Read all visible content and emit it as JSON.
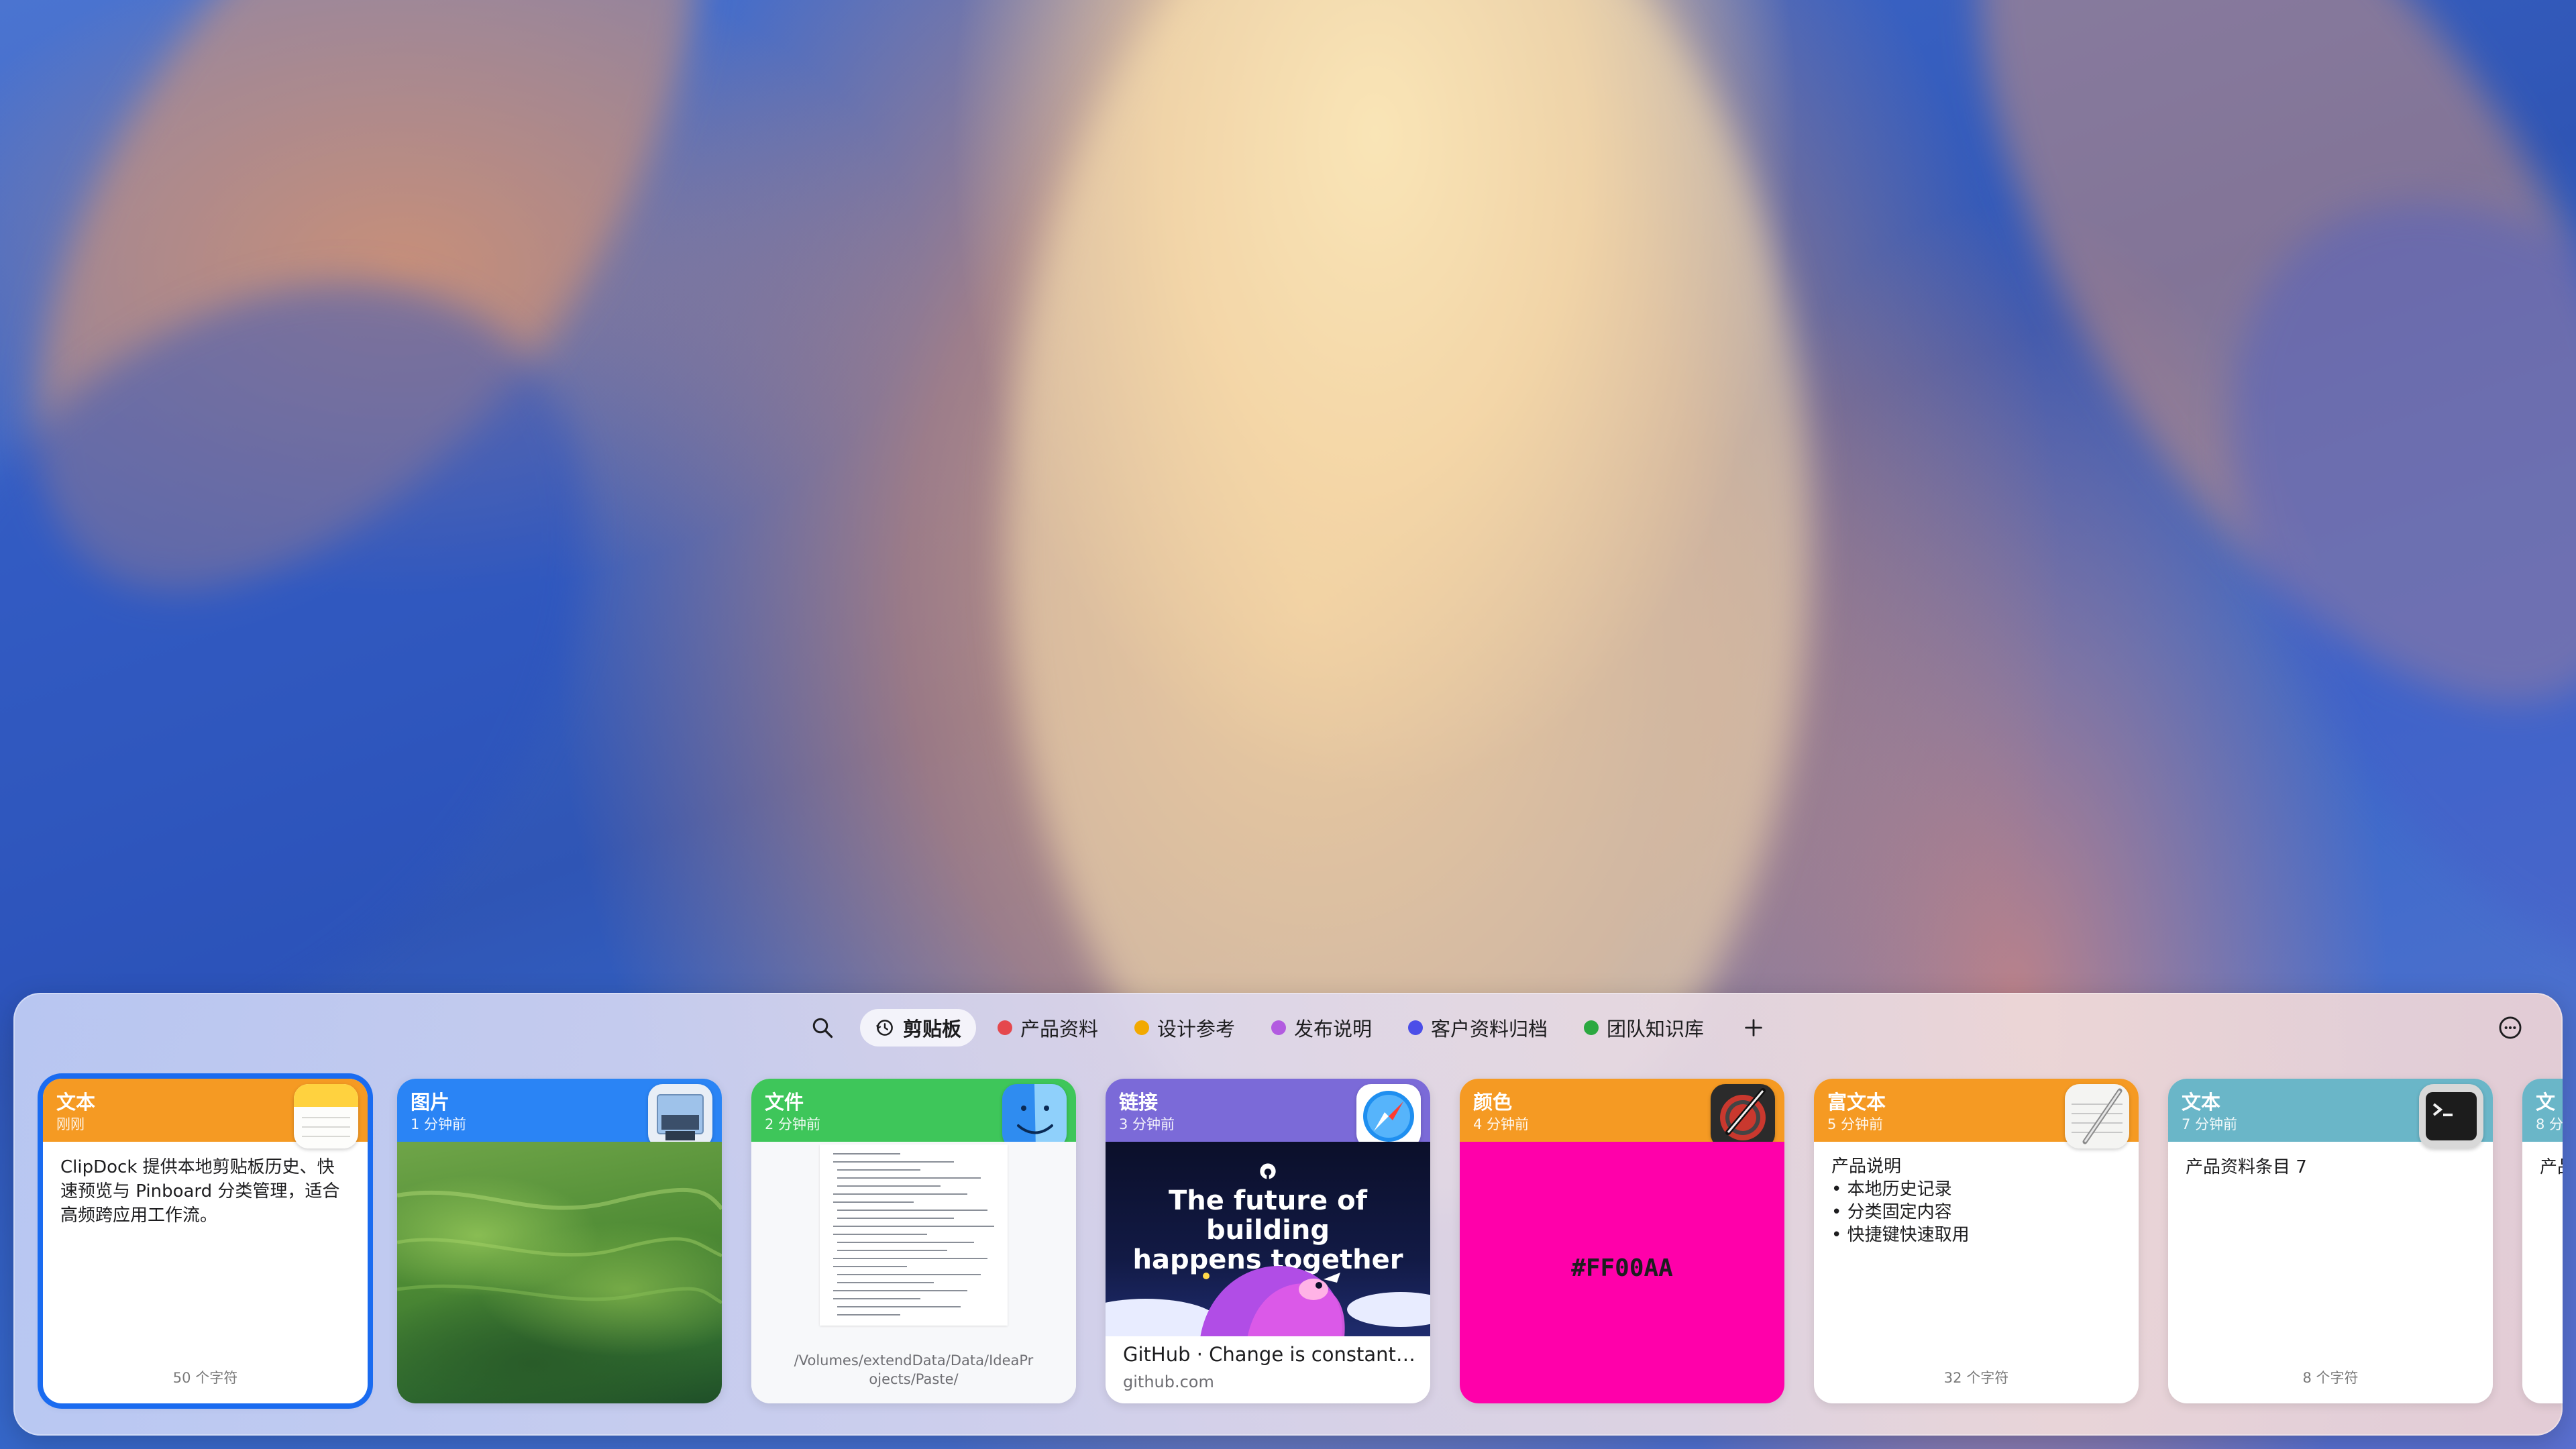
{
  "toolbar": {
    "tabs": [
      {
        "label": "剪贴板",
        "active": true
      },
      {
        "label": "产品资料",
        "color": "#e5484d"
      },
      {
        "label": "设计参考",
        "color": "#f2a900"
      },
      {
        "label": "发布说明",
        "color": "#b25be0"
      },
      {
        "label": "客户资料归档",
        "color": "#4b4ee8"
      },
      {
        "label": "团队知识库",
        "color": "#2ba840"
      }
    ]
  },
  "cards": [
    {
      "type": "文本",
      "time": "刚刚",
      "color": "#f59a23",
      "icon": "notes-app-icon",
      "content": "ClipDock 提供本地剪贴板历史、快速预览与 Pinboard 分类管理，适合高频跨应用工作流。",
      "count": "50 个字符",
      "selected": true
    },
    {
      "type": "图片",
      "time": "1 分钟前",
      "color": "#2a84f5",
      "icon": "preview-app-icon"
    },
    {
      "type": "文件",
      "time": "2 分钟前",
      "color": "#3ec65a",
      "icon": "finder-app-icon",
      "path": "/Volumes/extendData/Data/IdeaProjects/Paste/"
    },
    {
      "type": "链接",
      "time": "3 分钟前",
      "color": "#7b6ad8",
      "icon": "safari-app-icon",
      "hero_line1": "The future of building",
      "hero_line2": "happens together",
      "title": "GitHub · Change is constant....",
      "domain": "github.com"
    },
    {
      "type": "颜色",
      "time": "4 分钟前",
      "color": "#f59a23",
      "icon": "digital-color-meter-icon",
      "hex": "#FF00AA",
      "swatch": "#ff00aa"
    },
    {
      "type": "富文本",
      "time": "5 分钟前",
      "color": "#f59a23",
      "icon": "textedit-app-icon",
      "heading": "产品说明",
      "bullets": [
        "• 本地历史记录",
        "• 分类固定内容",
        "• 快捷键快速取用"
      ],
      "count": "32 个字符"
    },
    {
      "type": "文本",
      "time": "7 分钟前",
      "color": "#6ab6c8",
      "icon": "terminal-app-icon",
      "content": "产品资料条目 7",
      "count": "8 个字符"
    },
    {
      "type": "文",
      "time": "8 分",
      "color": "#6ab6c8",
      "content": "产品"
    }
  ]
}
